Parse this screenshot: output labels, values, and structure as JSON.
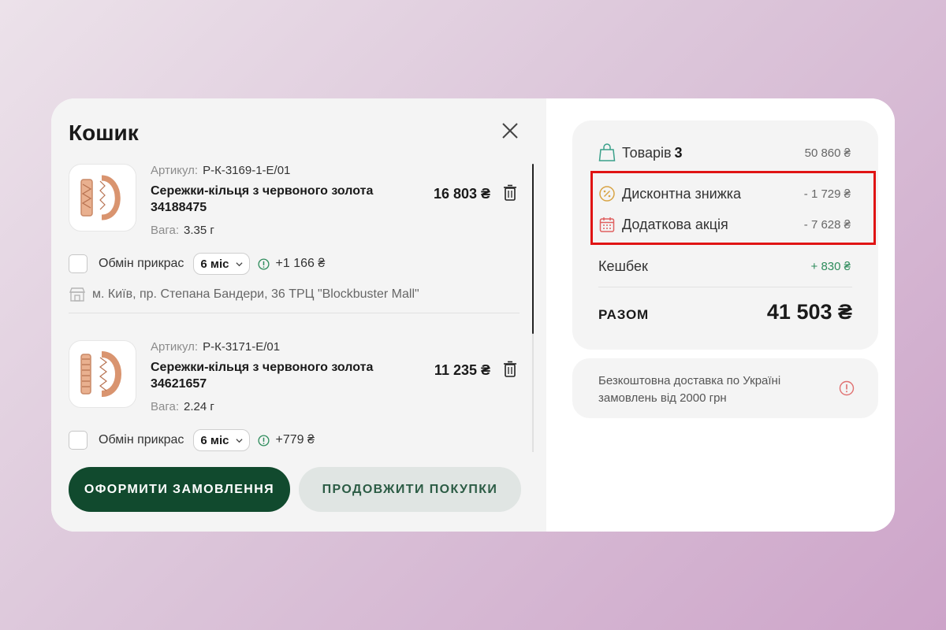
{
  "cart": {
    "title": "Кошик",
    "items": [
      {
        "article_label": "Артикул:",
        "article": "Р-К-3169-1-Е/01",
        "name": "Сережки-кільця з червоного золота 34188475",
        "weight_label": "Вага:",
        "weight": "3.35 г",
        "price": "16 803 ₴",
        "exchange_label": "Обмін прикрас",
        "exchange_period": "6 міс",
        "exchange_price": "+1 166 ₴",
        "store": "м. Київ, пр. Степана Бандери, 36 ТРЦ \"Blockbuster Mall\""
      },
      {
        "article_label": "Артикул:",
        "article": "Р-К-3171-Е/01",
        "name": "Сережки-кільця з червоного золота 34621657",
        "weight_label": "Вага:",
        "weight": "2.24 г",
        "price": "11 235 ₴",
        "exchange_label": "Обмін прикрас",
        "exchange_period": "6 міс",
        "exchange_price": "+779 ₴"
      }
    ],
    "checkout_button": "ОФОРМИТИ ЗАМОВЛЕННЯ",
    "continue_button": "ПРОДОВЖИТИ ПОКУПКИ"
  },
  "summary": {
    "goods_label": "Товарів",
    "goods_count": "3",
    "goods_value": "50 860 ₴",
    "discount_label": "Дисконтна знижка",
    "discount_value": "- 1 729 ₴",
    "promo_label": "Додаткова акція",
    "promo_value": "- 7 628 ₴",
    "cashback_label": "Кешбек",
    "cashback_value": "+ 830 ₴",
    "total_label": "РАЗОМ",
    "total_value": "41 503 ₴"
  },
  "delivery": {
    "text": "Безкоштовна доставка по Україні замовлень від 2000 грн"
  },
  "colors": {
    "primary": "#114a2e",
    "secondary_bg": "#e0e5e3",
    "highlight": "#e01414",
    "cashback": "#2e8c5c"
  }
}
